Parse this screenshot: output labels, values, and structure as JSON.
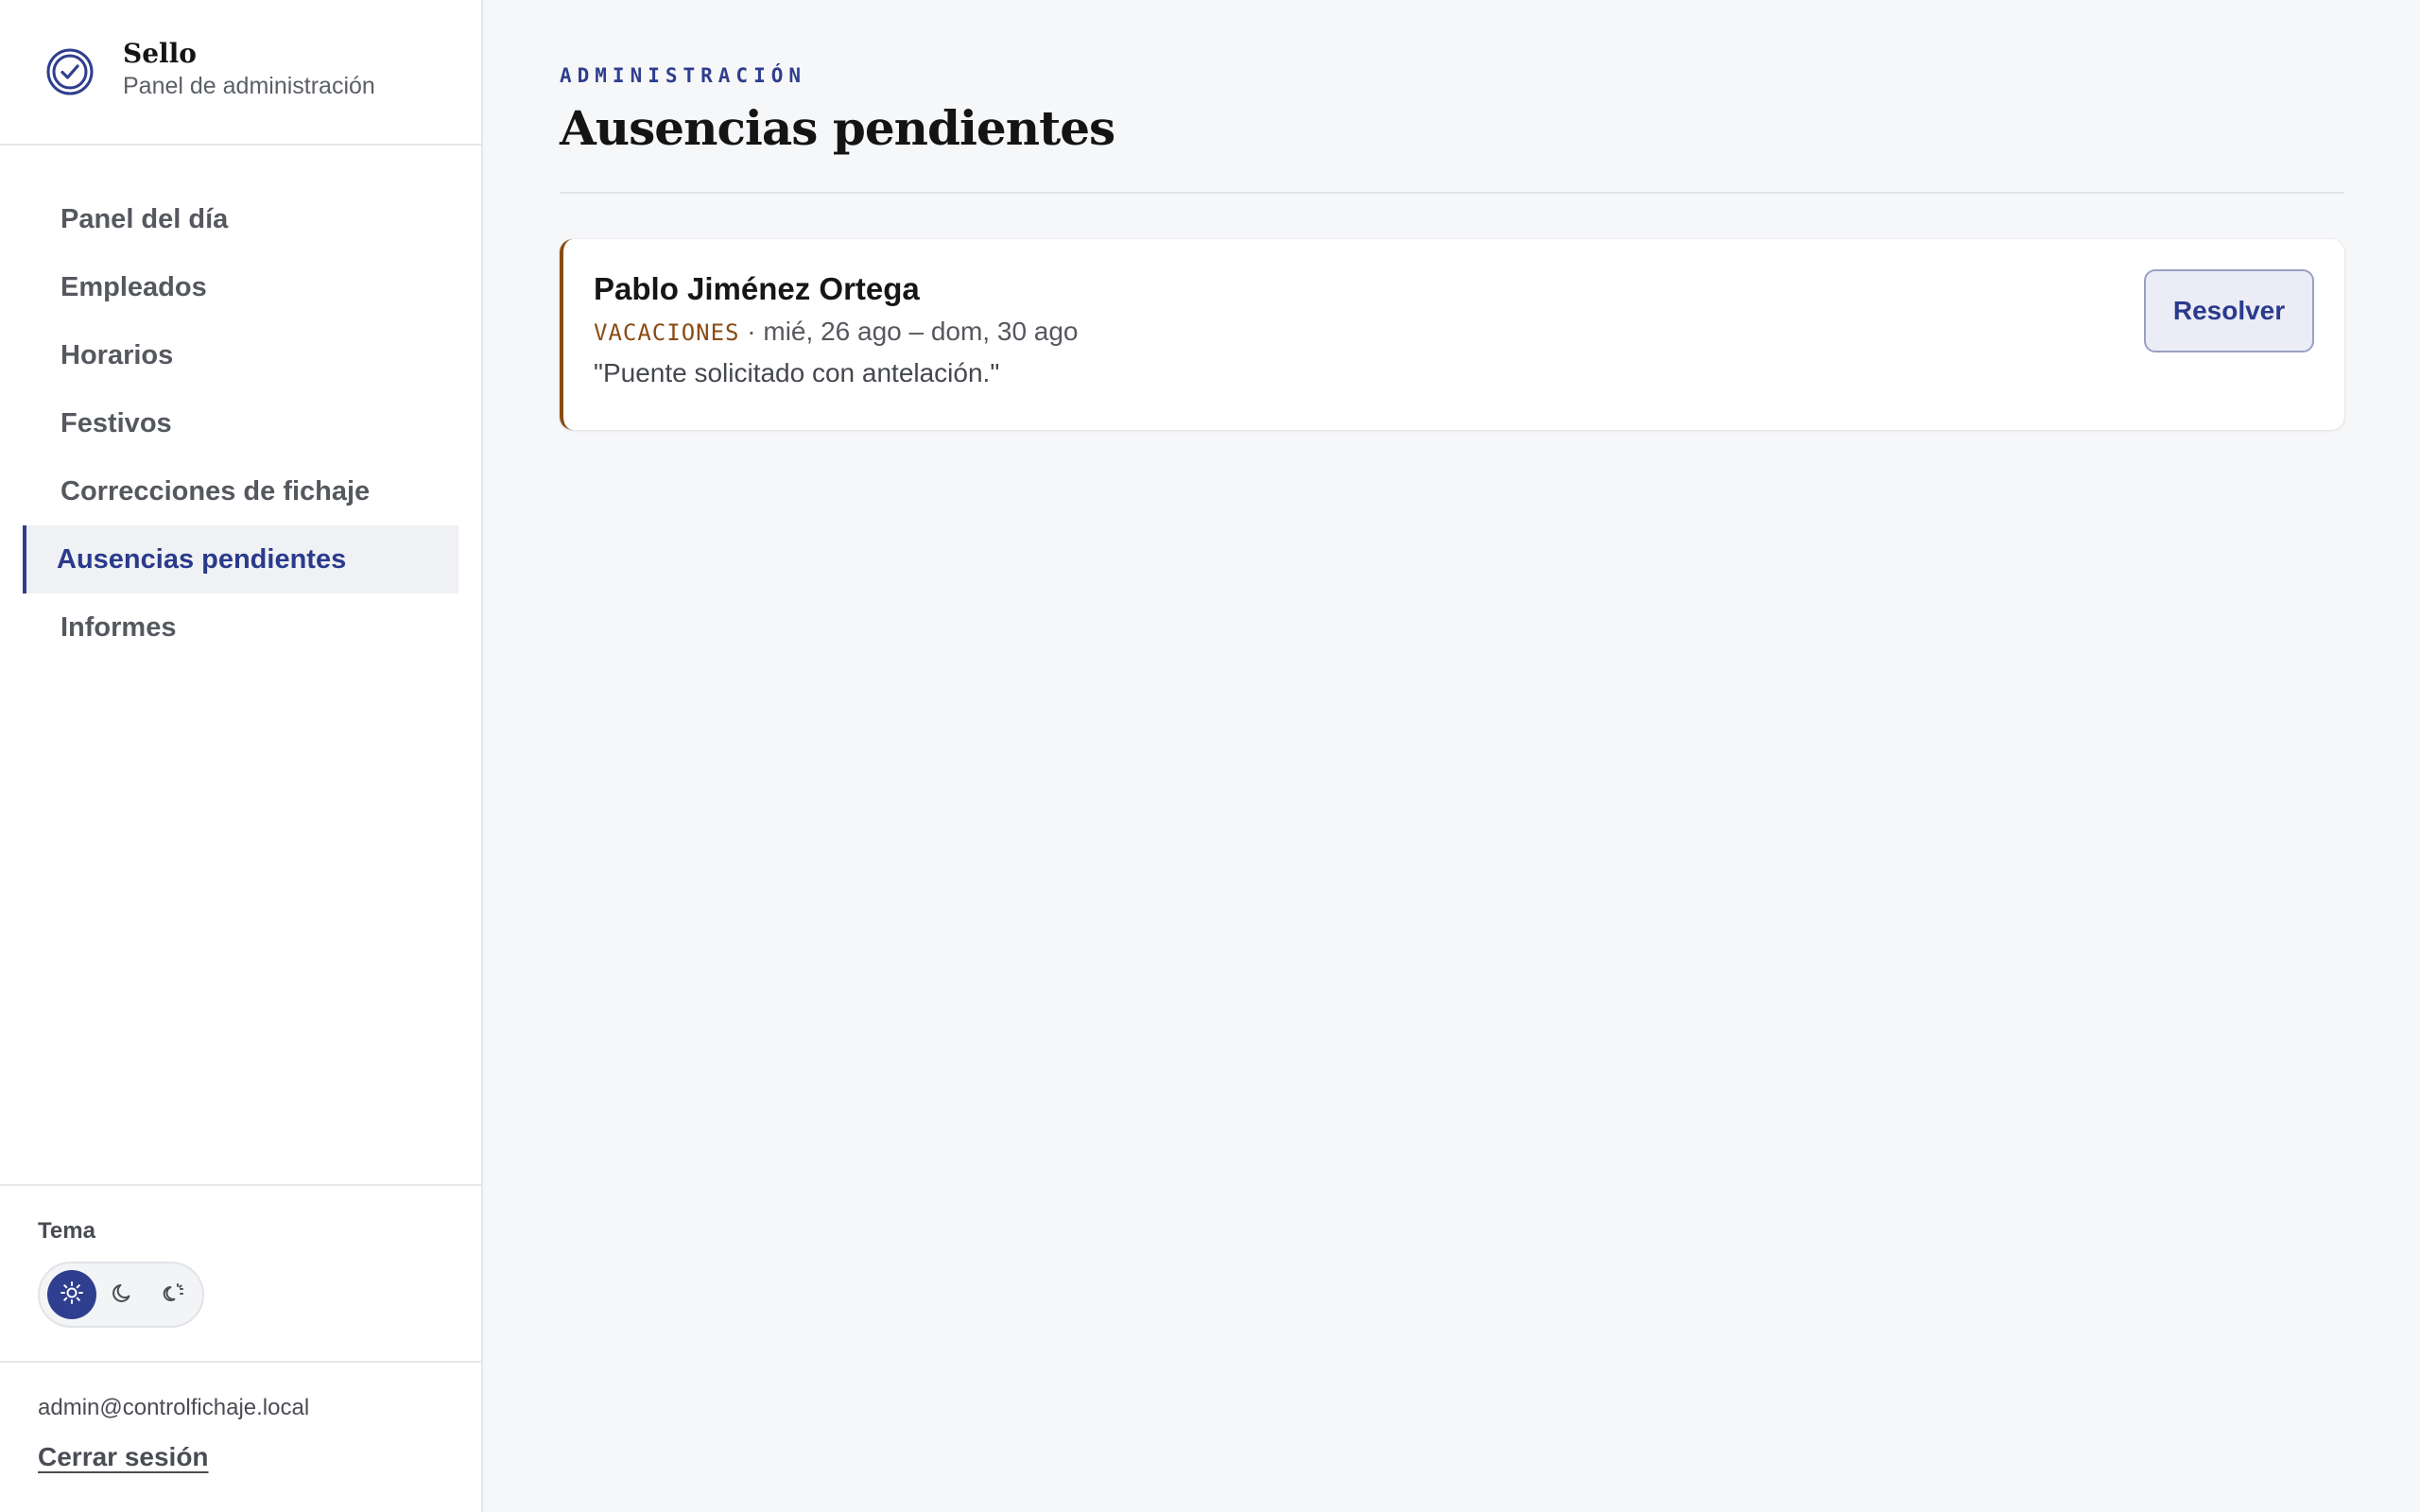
{
  "brand": {
    "name": "Sello",
    "subtitle": "Panel de administración",
    "logo_icon": "check-circle-icon"
  },
  "sidebar": {
    "items": [
      {
        "label": "Panel del día",
        "active": false
      },
      {
        "label": "Empleados",
        "active": false
      },
      {
        "label": "Horarios",
        "active": false
      },
      {
        "label": "Festivos",
        "active": false
      },
      {
        "label": "Correcciones de fichaje",
        "active": false
      },
      {
        "label": "Ausencias pendientes",
        "active": true
      },
      {
        "label": "Informes",
        "active": false
      }
    ]
  },
  "theme": {
    "label": "Tema",
    "options": [
      {
        "icon": "sun-icon",
        "selected": true
      },
      {
        "icon": "moon-icon",
        "selected": false
      },
      {
        "icon": "auto-theme-icon",
        "selected": false
      }
    ]
  },
  "account": {
    "email": "admin@controlfichaje.local",
    "logout_label": "Cerrar sesión"
  },
  "header": {
    "eyebrow": "ADMINISTRACIÓN",
    "title": "Ausencias pendientes"
  },
  "requests": [
    {
      "employee": "Pablo Jiménez Ortega",
      "type": "VACACIONES",
      "separator": " · ",
      "dates": "mié, 26 ago – dom, 30 ago",
      "note": "\"Puente solicitado con antelación.\"",
      "action_label": "Resolver"
    }
  ],
  "colors": {
    "accent": "#2f3e8e",
    "vacation": "#8a4b12",
    "background": "#f6f7f9"
  }
}
